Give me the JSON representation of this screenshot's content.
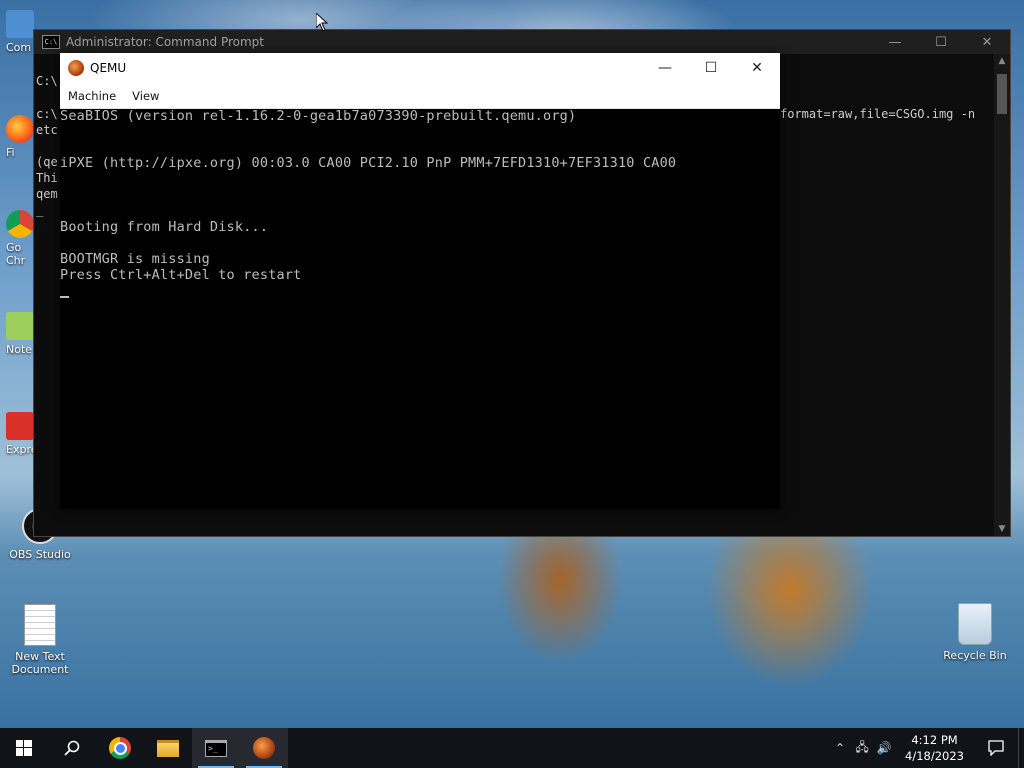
{
  "desktop": {
    "left_icons": [
      {
        "label": "Com"
      },
      {
        "label": "Fi"
      },
      {
        "label": "Go\nChr"
      },
      {
        "label": "Note"
      },
      {
        "label": "Expre"
      },
      {
        "label": "OBS Studio"
      },
      {
        "label": "New Text\nDocument"
      }
    ],
    "recycle_bin": {
      "label": "Recycle Bin"
    }
  },
  "cmd_window": {
    "title": "Administrator: Command Prompt",
    "visible_lines": [
      "C:\\",
      "c:\\",
      "etc",
      "(qe",
      "Thi",
      "qem",
      "_"
    ],
    "right_text": "format=raw,file=CSGO.img -n"
  },
  "qemu_window": {
    "title": "QEMU",
    "menu": [
      "Machine",
      "View"
    ],
    "screen_lines": [
      "SeaBIOS (version rel-1.16.2-0-gea1b7a073390-prebuilt.qemu.org)",
      "iPXE (http://ipxe.org) 00:03.0 CA00 PCI2.10 PnP PMM+7EFD1310+7EF31310 CA00",
      "Booting from Hard Disk...",
      "BOOTMGR is missing",
      "Press Ctrl+Alt+Del to restart"
    ]
  },
  "taskbar": {
    "clock_time": "4:12 PM",
    "clock_date": "4/18/2023",
    "apps": [
      "start-icon",
      "search-icon",
      "chrome-icon",
      "file-explorer-icon",
      "command-prompt-icon",
      "qemu-icon"
    ]
  }
}
